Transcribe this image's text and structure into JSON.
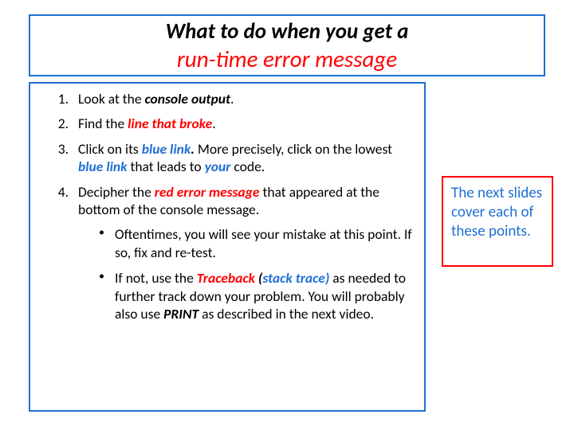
{
  "title": {
    "line1": "What to do when you get a",
    "line2": "run-time error message"
  },
  "list": {
    "item1_a": "Look at the ",
    "item1_b": "console output",
    "item1_c": ".",
    "item2_a": "Find the ",
    "item2_b": "line that broke",
    "item2_c": ".",
    "item3_a": "Click on its ",
    "item3_b": "blue link",
    "item3_c": ".",
    "item3_d": "  More precisely, click on the lowest ",
    "item3_e": "blue link",
    "item3_f": " that leads to ",
    "item3_g": "your",
    "item3_h": " code.",
    "item4_a": "Decipher the ",
    "item4_b": "red error message",
    "item4_c": " that appeared at the bottom of the console message.",
    "sub1": "Oftentimes, you will see your mistake at this point.  If so, fix and re-test.",
    "sub2_a": "If not, use the ",
    "sub2_b": "Traceback ",
    "sub2_c": "(",
    "sub2_d": "stack trace)",
    "sub2_e": " as needed to further track down your problem.  You will probably also use ",
    "sub2_f": "PRINT",
    "sub2_g": " as described in the next video."
  },
  "side": "The next slides cover each of these points."
}
